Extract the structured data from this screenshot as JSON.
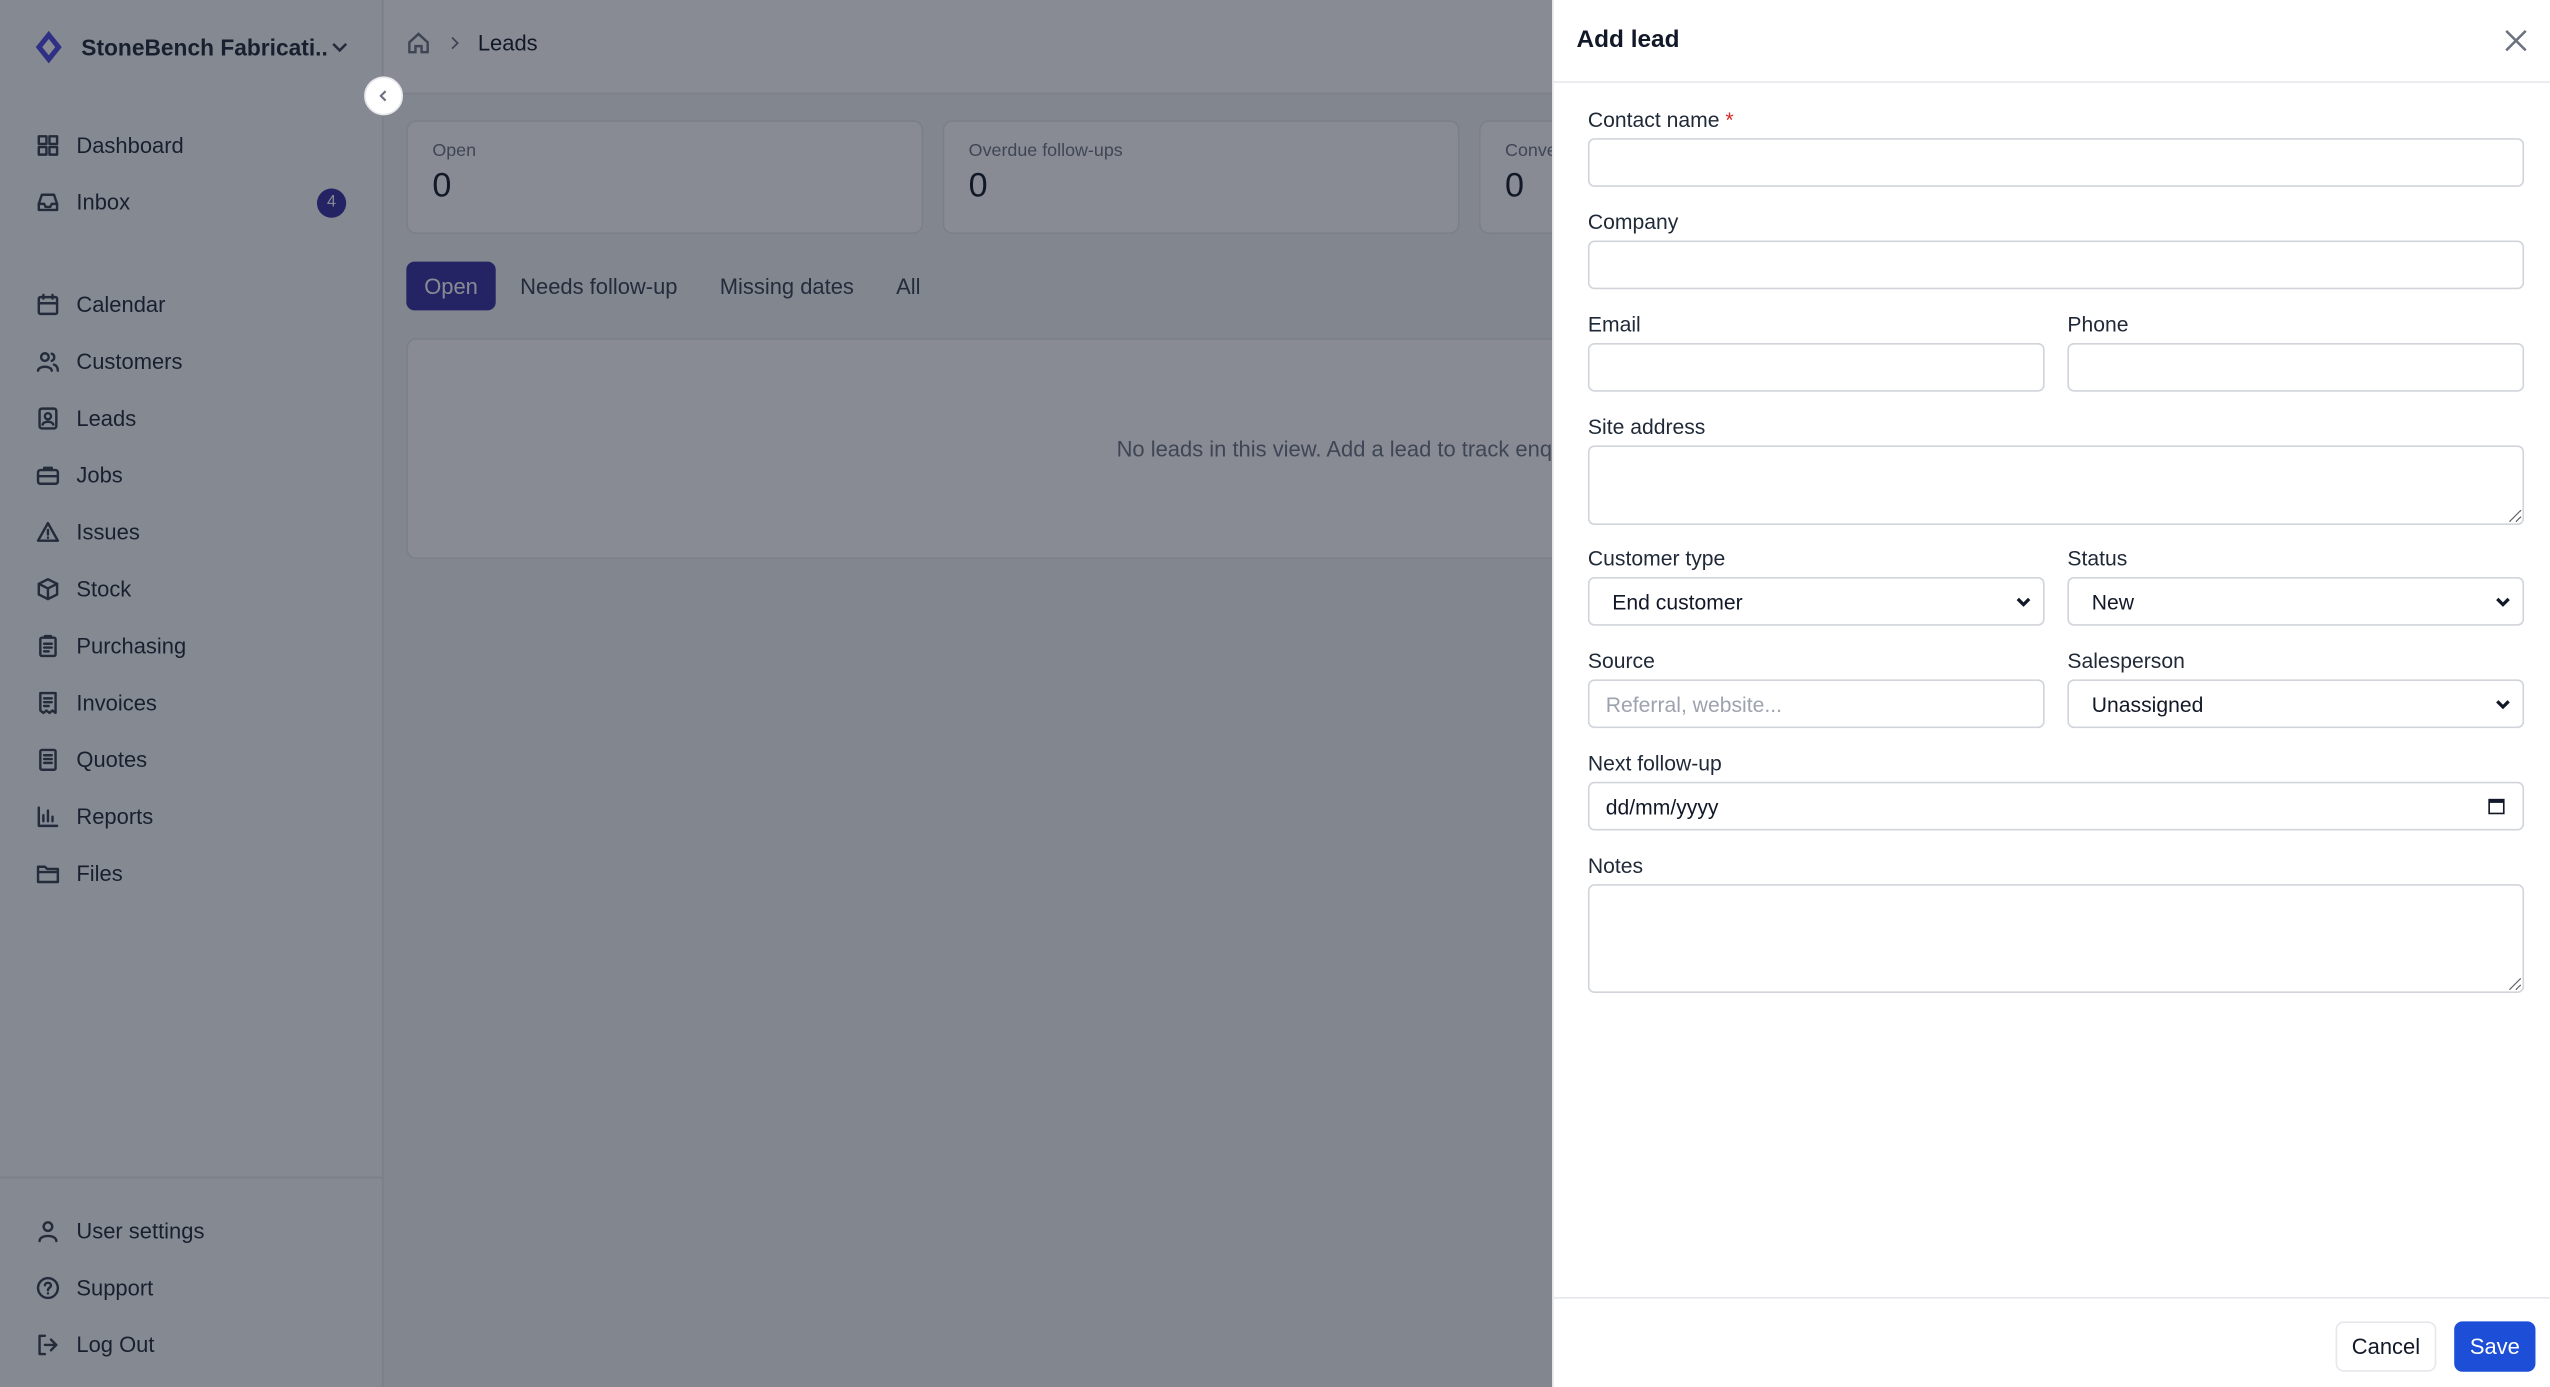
{
  "app": {
    "org_name": "StoneBench Fabricati..."
  },
  "sidebar": {
    "items": [
      {
        "label": "Dashboard",
        "icon": "dashboard-icon"
      },
      {
        "label": "Inbox",
        "icon": "inbox-icon",
        "badge": "4"
      },
      {
        "label": "Calendar",
        "icon": "calendar-icon"
      },
      {
        "label": "Customers",
        "icon": "users-icon"
      },
      {
        "label": "Leads",
        "icon": "contact-icon"
      },
      {
        "label": "Jobs",
        "icon": "briefcase-icon"
      },
      {
        "label": "Issues",
        "icon": "warning-icon"
      },
      {
        "label": "Stock",
        "icon": "box-icon"
      },
      {
        "label": "Purchasing",
        "icon": "clipboard-icon"
      },
      {
        "label": "Invoices",
        "icon": "receipt-icon"
      },
      {
        "label": "Quotes",
        "icon": "document-icon"
      },
      {
        "label": "Reports",
        "icon": "bar-chart-icon"
      },
      {
        "label": "Files",
        "icon": "folder-icon"
      }
    ],
    "bottom": [
      {
        "label": "User settings",
        "icon": "user-icon"
      },
      {
        "label": "Support",
        "icon": "help-icon"
      },
      {
        "label": "Log Out",
        "icon": "logout-icon"
      }
    ]
  },
  "breadcrumb": {
    "current": "Leads"
  },
  "stats": [
    {
      "label": "Open",
      "value": "0"
    },
    {
      "label": "Overdue follow-ups",
      "value": "0"
    },
    {
      "label": "Conve",
      "value": "0"
    }
  ],
  "tabs": [
    {
      "label": "Open",
      "active": true
    },
    {
      "label": "Needs follow-up",
      "active": false
    },
    {
      "label": "Missing dates",
      "active": false
    },
    {
      "label": "All",
      "active": false
    }
  ],
  "empty_state": "No leads in this view. Add a lead to track enqui",
  "drawer": {
    "title": "Add lead",
    "fields": {
      "contact_name": {
        "label": "Contact name",
        "required_mark": "*",
        "value": ""
      },
      "company": {
        "label": "Company",
        "value": ""
      },
      "email": {
        "label": "Email",
        "value": ""
      },
      "phone": {
        "label": "Phone",
        "value": ""
      },
      "site_address": {
        "label": "Site address",
        "value": ""
      },
      "customer_type": {
        "label": "Customer type",
        "value": "End customer"
      },
      "status": {
        "label": "Status",
        "value": "New"
      },
      "source": {
        "label": "Source",
        "placeholder": "Referral, website...",
        "value": ""
      },
      "salesperson": {
        "label": "Salesperson",
        "value": "Unassigned"
      },
      "next_follow_up": {
        "label": "Next follow-up",
        "value": "dd/mm/yyyy"
      },
      "notes": {
        "label": "Notes",
        "value": ""
      }
    },
    "cancel_label": "Cancel",
    "save_label": "Save"
  },
  "colors": {
    "accent": "#3730a3",
    "save": "#1d4ed8",
    "required": "#dc2626"
  }
}
